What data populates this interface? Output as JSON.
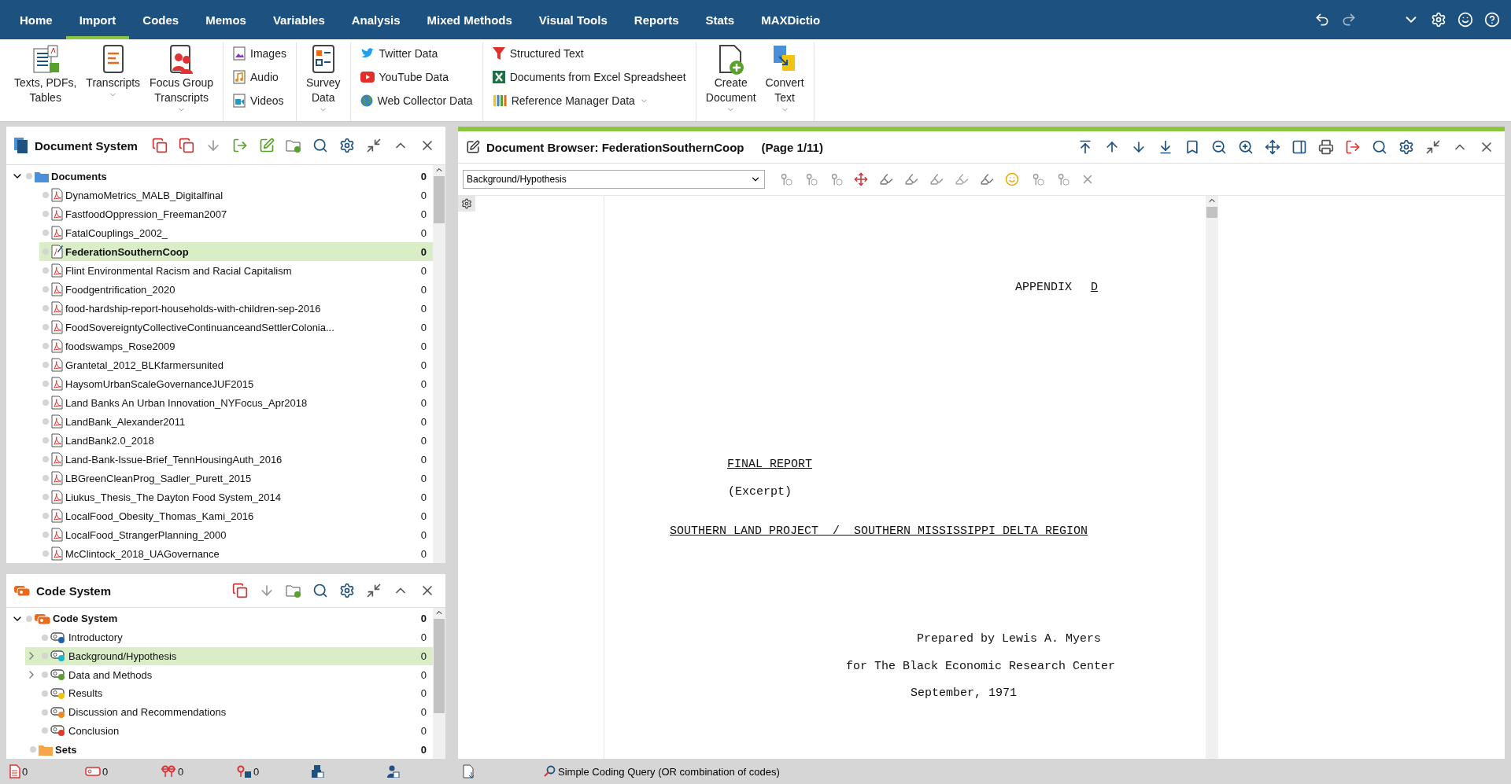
{
  "menu": {
    "tabs": [
      {
        "label": "Home",
        "selected": false
      },
      {
        "label": "Import",
        "selected": true
      },
      {
        "label": "Codes",
        "selected": false
      },
      {
        "label": "Memos",
        "selected": false
      },
      {
        "label": "Variables",
        "selected": false
      },
      {
        "label": "Analysis",
        "selected": false
      },
      {
        "label": "Mixed Methods",
        "selected": false
      },
      {
        "label": "Visual Tools",
        "selected": false
      },
      {
        "label": "Reports",
        "selected": false
      },
      {
        "label": "Stats",
        "selected": false
      },
      {
        "label": "MAXDictio",
        "selected": false
      }
    ]
  },
  "ribbon": {
    "groups": [
      {
        "kind": "large",
        "items": [
          {
            "label": "Texts, PDFs,\nTables",
            "dropdown": false
          },
          {
            "label": "Transcripts\n",
            "dropdown": true
          },
          {
            "label": "Focus Group\nTranscripts",
            "dropdown": true
          }
        ]
      },
      {
        "kind": "stack",
        "items": [
          {
            "label": "Images",
            "dropdown": false
          },
          {
            "label": "Audio",
            "dropdown": false
          },
          {
            "label": "Videos",
            "dropdown": false
          }
        ]
      },
      {
        "kind": "large",
        "items": [
          {
            "label": "Survey\nData",
            "dropdown": true
          }
        ]
      },
      {
        "kind": "stack",
        "items": [
          {
            "label": "Twitter Data",
            "dropdown": false
          },
          {
            "label": "YouTube Data",
            "dropdown": false
          },
          {
            "label": "Web Collector Data",
            "dropdown": false
          }
        ]
      },
      {
        "kind": "stack",
        "items": [
          {
            "label": "Structured Text",
            "dropdown": false
          },
          {
            "label": "Documents from Excel Spreadsheet",
            "dropdown": false
          },
          {
            "label": "Reference Manager Data",
            "dropdown": true
          }
        ]
      },
      {
        "kind": "large",
        "items": [
          {
            "label": "Create\nDocument",
            "dropdown": true
          },
          {
            "label": "Convert\nText",
            "dropdown": true
          }
        ]
      }
    ]
  },
  "document_system": {
    "title": "Document System",
    "root": {
      "label": "Documents",
      "count": "0",
      "expanded": true,
      "children": [
        {
          "label": "DynamoMetrics_MALB_Digitalfinal",
          "count": "0",
          "selected": false
        },
        {
          "label": "FastfoodOppression_Freeman2007",
          "count": "0",
          "selected": false
        },
        {
          "label": "FatalCouplings_2002_",
          "count": "0",
          "selected": false
        },
        {
          "label": "FederationSouthernCoop",
          "count": "0",
          "selected": true
        },
        {
          "label": "Flint Environmental Racism and Racial Capitalism",
          "count": "0",
          "selected": false
        },
        {
          "label": "Foodgentrification_2020",
          "count": "0",
          "selected": false
        },
        {
          "label": "food-hardship-report-households-with-children-sep-2016",
          "count": "0",
          "selected": false
        },
        {
          "label": "FoodSovereigntyCollectiveContinuanceandSettlerColonia...",
          "count": "0",
          "selected": false
        },
        {
          "label": "foodswamps_Rose2009",
          "count": "0",
          "selected": false
        },
        {
          "label": "Grantetal_2012_BLKfarmersunited",
          "count": "0",
          "selected": false
        },
        {
          "label": "HaysomUrbanScaleGovernanceJUF2015",
          "count": "0",
          "selected": false
        },
        {
          "label": "Land Banks An Urban Innovation_NYFocus_Apr2018",
          "count": "0",
          "selected": false
        },
        {
          "label": "LandBank_Alexander2011",
          "count": "0",
          "selected": false
        },
        {
          "label": "LandBank2.0_2018",
          "count": "0",
          "selected": false
        },
        {
          "label": "Land-Bank-Issue-Brief_TennHousingAuth_2016",
          "count": "0",
          "selected": false
        },
        {
          "label": "LBGreenCleanProg_Sadler_Purett_2015",
          "count": "0",
          "selected": false
        },
        {
          "label": "Liukus_Thesis_The Dayton Food System_2014",
          "count": "0",
          "selected": false
        },
        {
          "label": "LocalFood_Obesity_Thomas_Kami_2016",
          "count": "0",
          "selected": false
        },
        {
          "label": "LocalFood_StrangerPlanning_2000",
          "count": "0",
          "selected": false
        },
        {
          "label": "McClintock_2018_UAGovernance",
          "count": "0",
          "selected": false
        }
      ]
    }
  },
  "code_system": {
    "title": "Code System",
    "root": {
      "label": "Code System",
      "count": "0",
      "expanded": true,
      "children": [
        {
          "label": "Introductory",
          "count": "0",
          "color": "#1f5fb4",
          "has_children": false,
          "selected": false
        },
        {
          "label": "Background/Hypothesis",
          "count": "0",
          "color": "#19b5c8",
          "has_children": true,
          "selected": true
        },
        {
          "label": "Data and Methods",
          "count": "0",
          "color": "#5aa02c",
          "has_children": true,
          "selected": false
        },
        {
          "label": "Results",
          "count": "0",
          "color": "#f2c40f",
          "has_children": false,
          "selected": false
        },
        {
          "label": "Discussion and Recommendations",
          "count": "0",
          "color": "#f08a24",
          "has_children": false,
          "selected": false
        },
        {
          "label": "Conclusion",
          "count": "0",
          "color": "#e03a2a",
          "has_children": false,
          "selected": false
        }
      ]
    },
    "sets": {
      "label": "Sets",
      "count": "0"
    }
  },
  "document_browser": {
    "title": "Document Browser: FederationSouthernCoop",
    "page": "(Page 1/11)",
    "code_select": {
      "value": "Background/Hypothesis"
    },
    "lines": [
      {
        "kind": "heading",
        "segments": [
          {
            "text": "APPENDIX",
            "underline": false
          },
          {
            "text": "D",
            "underline": true
          }
        ]
      },
      {
        "kind": "title",
        "segments": [
          {
            "text": "FINAL REPORT",
            "underline": true
          }
        ]
      },
      {
        "kind": "subtitle",
        "segments": [
          {
            "text": "(Excerpt)",
            "underline": false
          }
        ]
      },
      {
        "kind": "banner",
        "segments": [
          {
            "text": "SOUTHERN LAND PROJECT  /  SOUTHERN MISSISSIPPI DELTA REGION",
            "underline": true
          }
        ]
      },
      {
        "kind": "byline",
        "segments": [
          {
            "text": "Prepared by Lewis A. Myers",
            "underline": false
          }
        ]
      },
      {
        "kind": "affiliation",
        "segments": [
          {
            "text": "for The Black Economic Research Center",
            "underline": false
          }
        ]
      },
      {
        "kind": "date",
        "segments": [
          {
            "text": "September, 1971",
            "underline": false
          }
        ]
      }
    ]
  },
  "status_bar": {
    "counts": [
      "0",
      "0",
      "0",
      "0"
    ],
    "query": "Simple Coding Query (OR combination of codes)"
  }
}
